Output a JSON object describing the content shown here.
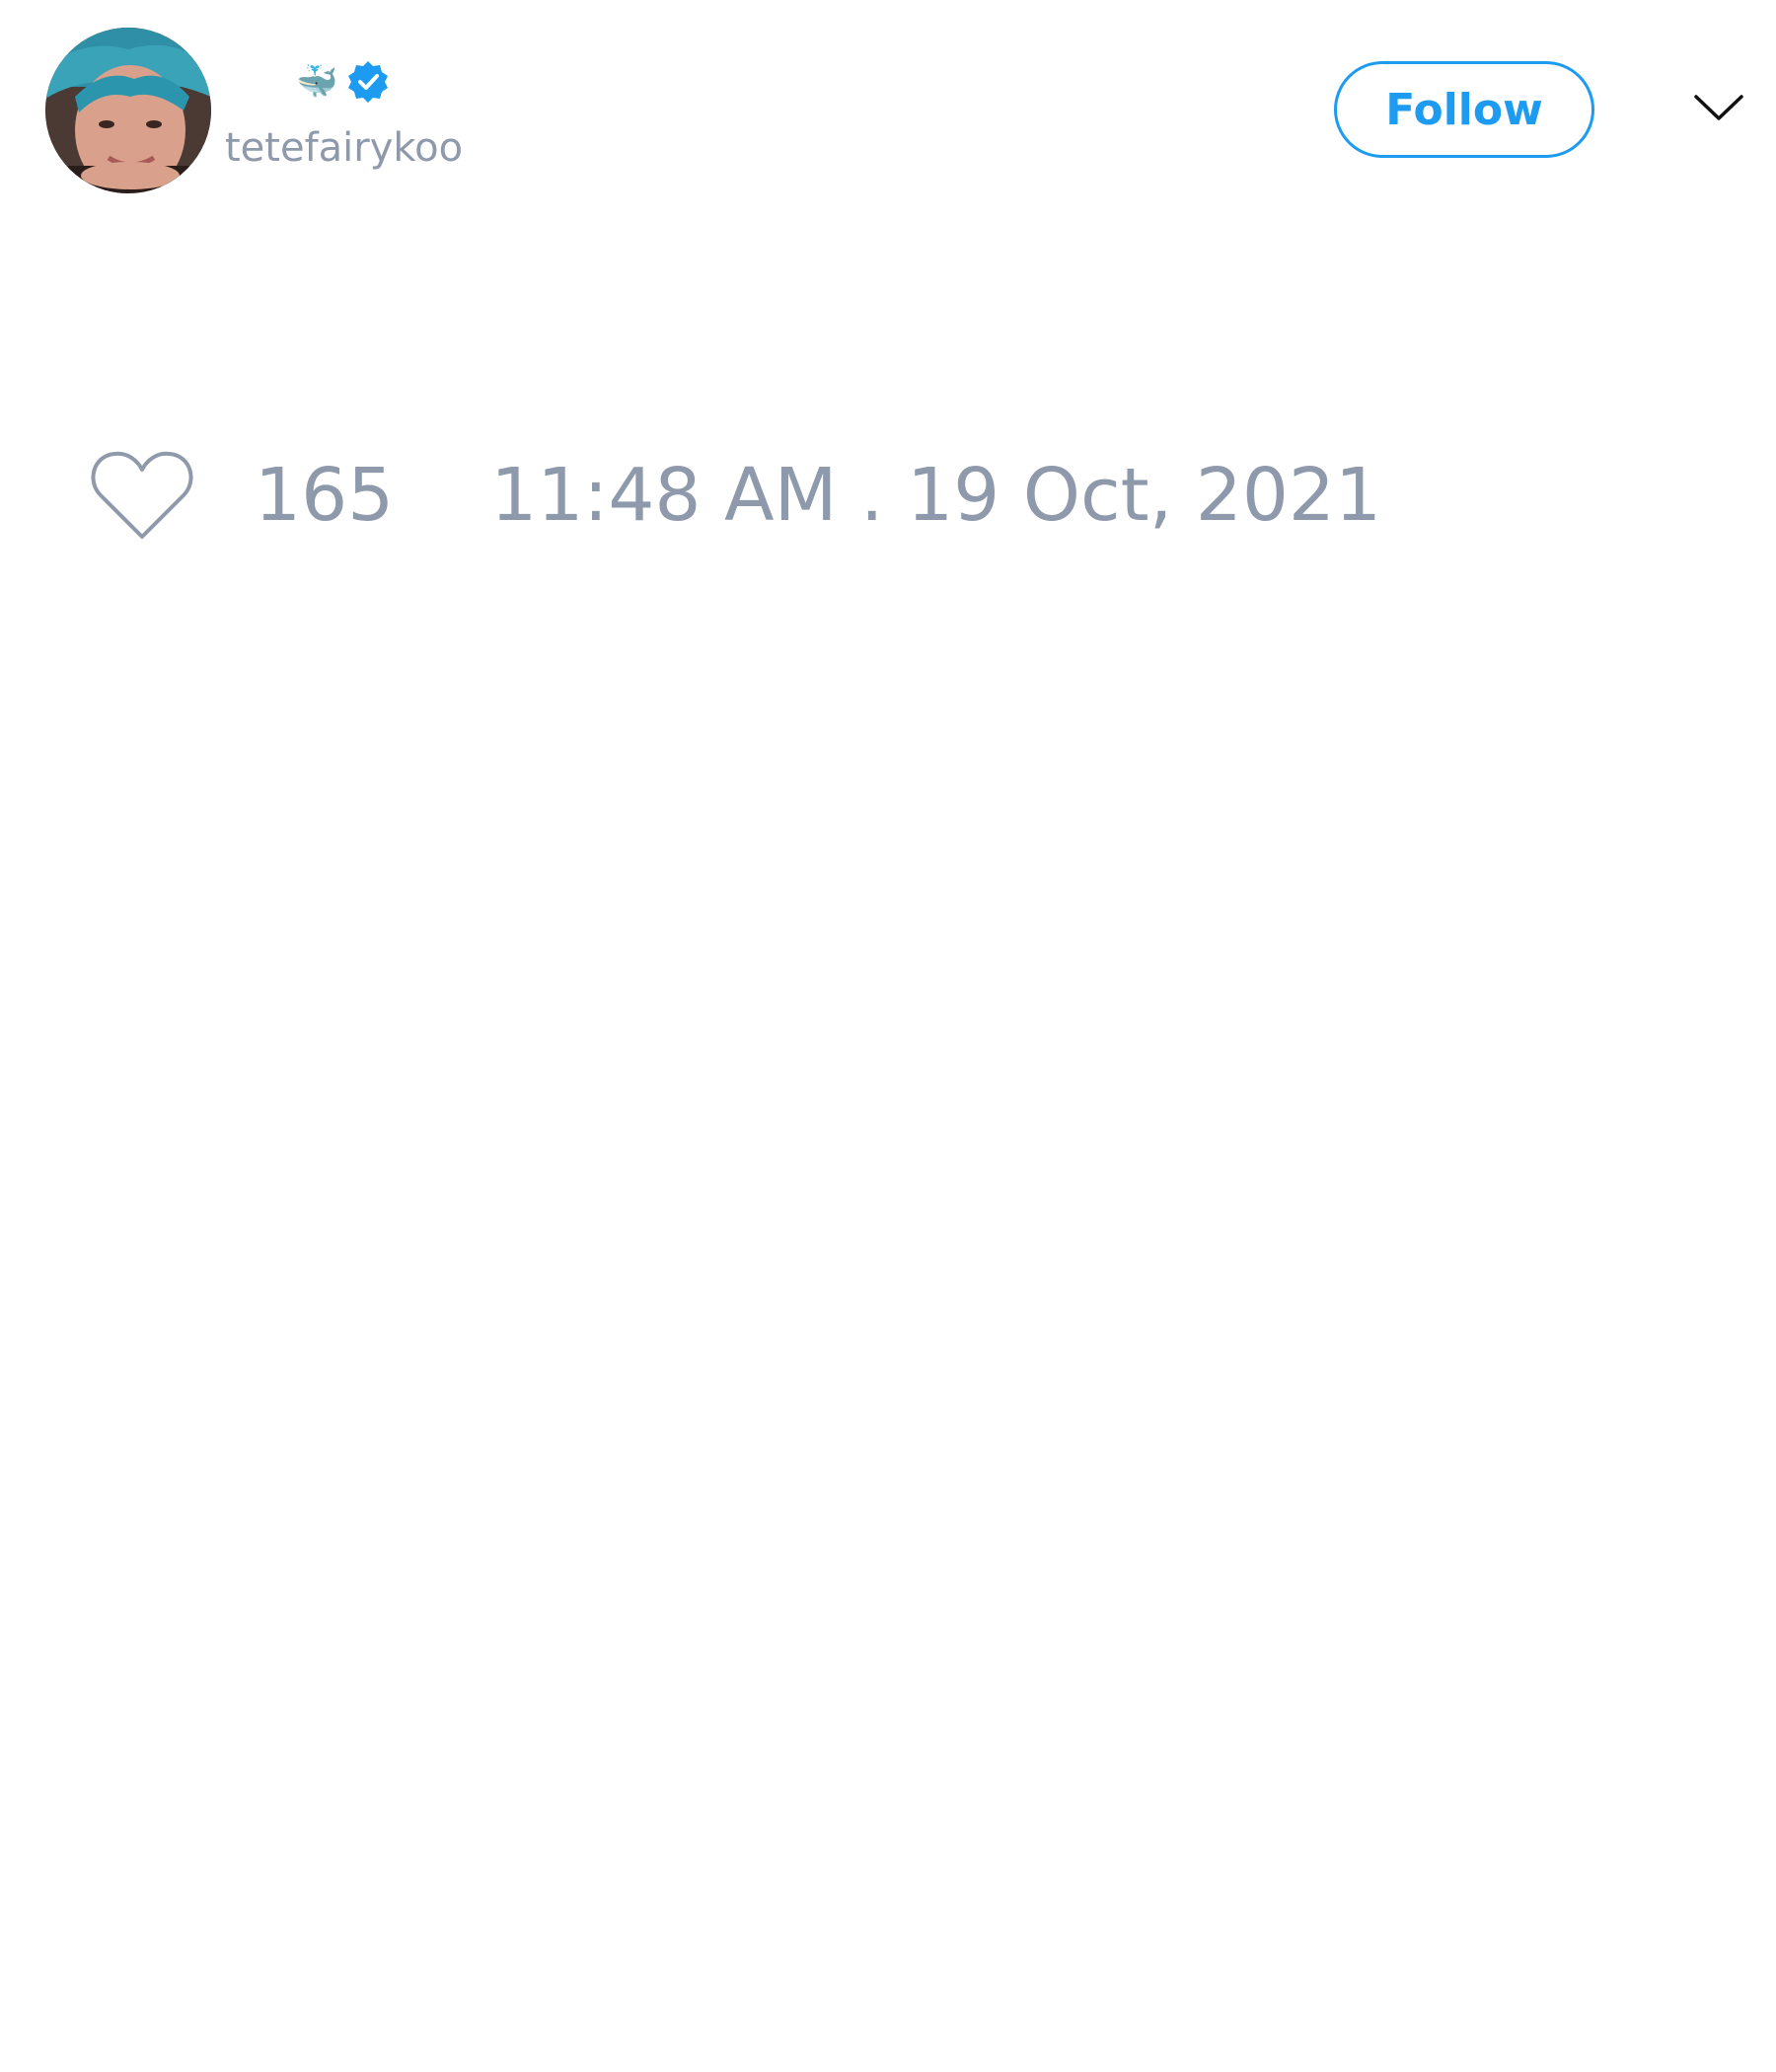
{
  "tweet": {
    "author": {
      "display_name": "🐳",
      "handle": "tetefairykoo",
      "verified": true,
      "avatar_icon": "profile-photo"
    },
    "follow_label": "Follow",
    "menu_icon": "chevron-down-icon",
    "likes": {
      "icon": "heart-icon",
      "count": "165"
    },
    "timestamp": "11:48 AM . 19 Oct, 2021"
  },
  "colors": {
    "accent": "#1d9bf0",
    "muted_text": "#8e9aab",
    "background": "#ffffff"
  }
}
